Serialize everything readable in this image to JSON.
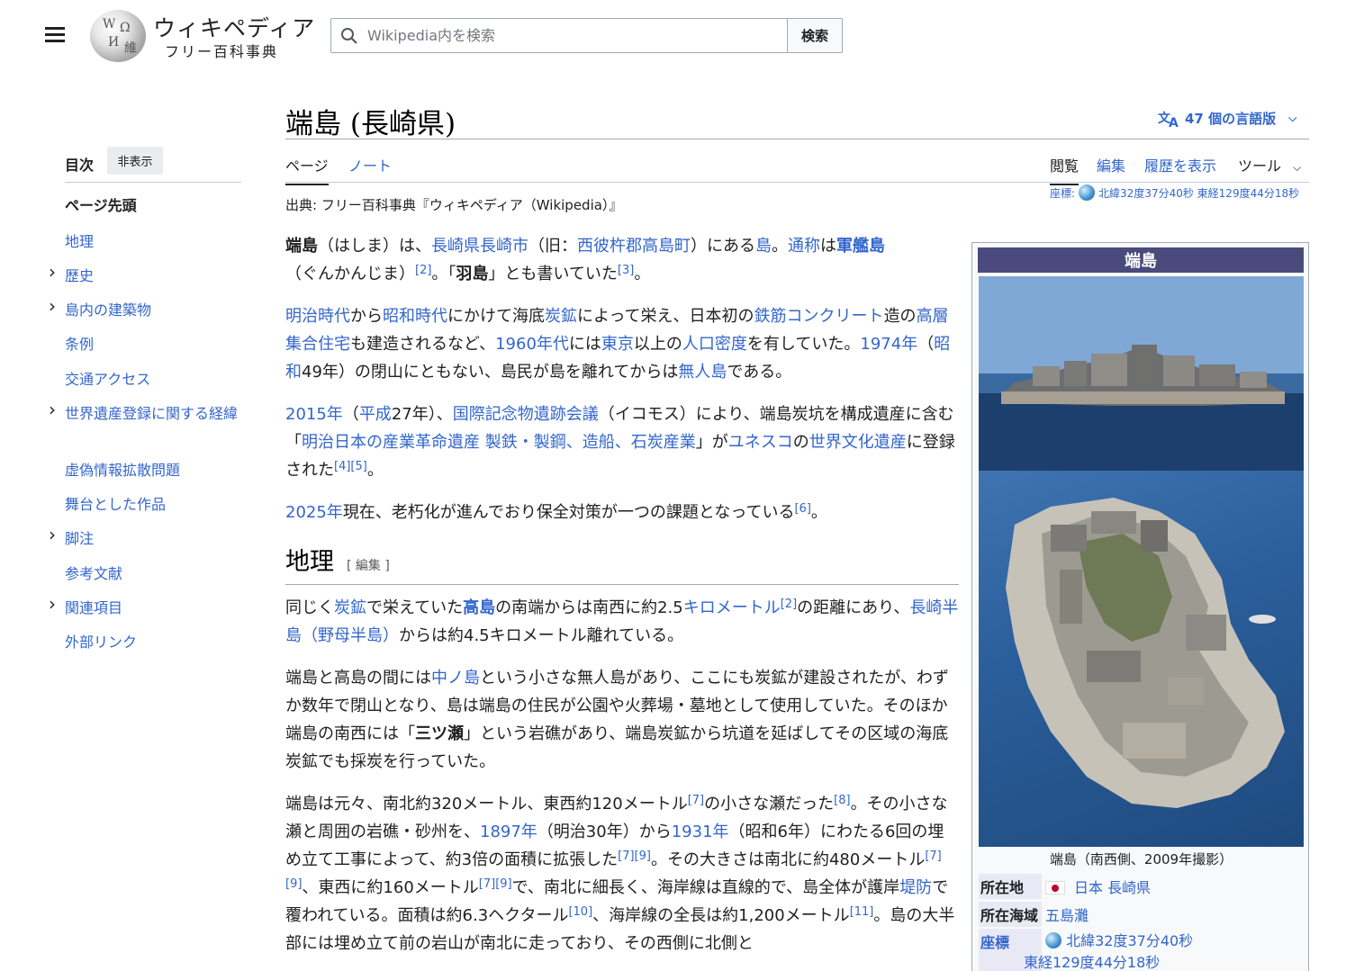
{
  "header": {
    "logo_title": "ウィキペディア",
    "logo_subtitle": "フリー百科事典",
    "search_placeholder": "Wikipedia内を検索",
    "search_button": "検索"
  },
  "toc": {
    "title": "目次",
    "hide_button": "非表示",
    "items": [
      {
        "label": "ページ先頭",
        "expandable": false,
        "top": true
      },
      {
        "label": "地理",
        "expandable": false
      },
      {
        "label": "歴史",
        "expandable": true
      },
      {
        "label": "島内の建築物",
        "expandable": true
      },
      {
        "label": "条例",
        "expandable": false
      },
      {
        "label": "交通アクセス",
        "expandable": false
      },
      {
        "label": "世界遺産登録に関する経緯",
        "expandable": true
      },
      {
        "label": "虚偽情報拡散問題",
        "expandable": false
      },
      {
        "label": "舞台とした作品",
        "expandable": false
      },
      {
        "label": "脚注",
        "expandable": true
      },
      {
        "label": "参考文献",
        "expandable": false
      },
      {
        "label": "関連項目",
        "expandable": true
      },
      {
        "label": "外部リンク",
        "expandable": false
      }
    ]
  },
  "page": {
    "title": "端島 (長崎県)",
    "languages": "47 個の言語版",
    "tabs": {
      "page": "ページ",
      "talk": "ノート",
      "read": "閲覧",
      "edit": "編集",
      "history": "履歴を表示",
      "tools": "ツール"
    },
    "coord_top": "北緯32度37分40秒 東経129度44分18秒",
    "coord_label": "座標:",
    "source": "出典: フリー百科事典『ウィキペディア（Wikipedia）』"
  },
  "article": {
    "p1": {
      "s1": "端島",
      "s2": "（はしま）は、",
      "s3": "長崎県長崎市",
      "s4": "（旧：",
      "s5": "西彼杵郡高島町",
      "s6": "）にある",
      "s7": "島",
      "s8": "。",
      "s9": "通称",
      "s10": "は",
      "s11": "軍艦島",
      "s12": "（ぐんかんじま）",
      "r1": "[2]",
      "s13": "。「",
      "s14": "羽島",
      "s15": "」とも書いていた",
      "r2": "[3]",
      "s16": "。"
    },
    "p2": {
      "s1": "明治時代",
      "s2": "から",
      "s3": "昭和時代",
      "s4": "にかけて海底",
      "s5": "炭鉱",
      "s6": "によって栄え、日本初の",
      "s7": "鉄筋コンクリート",
      "s8": "造の",
      "s9": "高層集合住宅",
      "s10": "も建造されるなど、",
      "s11": "1960年代",
      "s12": "には",
      "s13": "東京",
      "s14": "以上の",
      "s15": "人口密度",
      "s16": "を有していた。",
      "s17": "1974年",
      "s18": "（",
      "s19": "昭和",
      "s20": "49年）の閉山にともない、島民が島を離れてからは",
      "s21": "無人島",
      "s22": "である。"
    },
    "p3": {
      "s1": "2015年",
      "s2": "（",
      "s3": "平成",
      "s4": "27年）、",
      "s5": "国際記念物遺跡会議",
      "s6": "（イコモス）により、端島炭坑を構成遺産に含む「",
      "s7": "明治日本の産業革命遺産 製鉄・製鋼、造船、石炭産業",
      "s8": "」が",
      "s9": "ユネスコ",
      "s10": "の",
      "s11": "世界文化遺産",
      "s12": "に登録された",
      "r1": "[4]",
      "r2": "[5]",
      "s13": "。"
    },
    "p4": {
      "s1": "2025年",
      "s2": "現在、老朽化が進んでおり保全対策が一つの課題となっている",
      "r1": "[6]",
      "s3": "。"
    },
    "h2_geo": "地理",
    "h2_edit": "[ 編集 ]",
    "p5": {
      "s1": "同じく",
      "s2": "炭鉱",
      "s3": "で栄えていた",
      "s4": "高島",
      "s5": "の南端からは南西に約2.5",
      "s6": "キロメートル",
      "r1": "[2]",
      "s7": "の距離にあり、",
      "s8": "長崎半島（野母半島）",
      "s9": "からは約4.5キロメートル離れている。"
    },
    "p6": {
      "s1": "端島と高島の間には",
      "s2": "中ノ島",
      "s3": "という小さな無人島があり、ここにも炭鉱が建設されたが、わずか数年で閉山となり、島は端島の住民が公園や火葬場・墓地として使用していた。そのほか端島の南西には「",
      "s4": "三ツ瀬",
      "s5": "」という岩礁があり、端島炭鉱から坑道を延ばしてその区域の海底炭鉱でも採炭を行っていた。"
    },
    "p7": {
      "s1": "端島は元々、南北約320メートル、東西約120メートル",
      "r1": "[7]",
      "s2": "の小さな瀬だった",
      "r2": "[8]",
      "s3": "。その小さな瀬と周囲の岩礁・砂州を、",
      "s4": "1897年",
      "s5": "（明治30年）から",
      "s6": "1931年",
      "s7": "（昭和6年）にわたる6回の埋め立て工事によって、約3倍の面積に拡張した",
      "r3": "[7]",
      "r4": "[9]",
      "s8": "。その大きさは南北に約480メートル",
      "r5": "[7]",
      "r6": "[9]",
      "s9": "、東西に約160メートル",
      "r7": "[7]",
      "r8": "[9]",
      "s10": "で、南北に細長く、海岸線は直線的で、島全体が護岸",
      "s11": "堤防",
      "s12": "で覆われている。面積は約6.3ヘクタール",
      "r9": "[10]",
      "s13": "、海岸線の全長は約1,200メートル",
      "r10": "[11]",
      "s14": "。島の大半部には埋め立て前の岩山が南北に走っており、その西側に北側と"
    }
  },
  "infobox": {
    "title": "端島",
    "caption": "端島（南西側、2009年撮影）",
    "rows": {
      "location_label": "所在地",
      "location_value": "日本 長崎県",
      "sea_label": "所在海域",
      "sea_value": "五島灘",
      "coord_label": "座標",
      "coord_line1": "北緯32度37分40秒",
      "coord_line2": "東経129度44分18秒"
    }
  }
}
